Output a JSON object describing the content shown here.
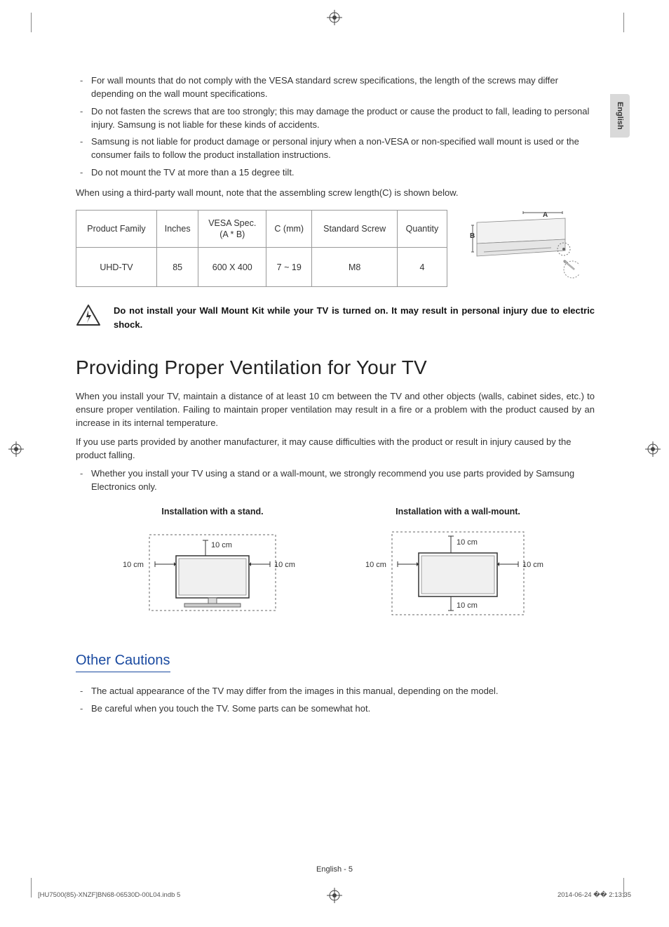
{
  "side_tab": "English",
  "warnings_top": [
    "For wall mounts that do not comply with the VESA standard screw specifications, the length of the screws may differ depending on the wall mount specifications.",
    "Do not fasten the screws that are too strongly; this may damage the product or cause the product to fall, leading to personal injury. Samsung is not liable for these kinds of accidents.",
    "Samsung is not liable for product damage or personal injury when a non-VESA or non-specified wall mount is used or the consumer fails to follow the product installation instructions.",
    "Do not mount the TV at more than a 15 degree tilt."
  ],
  "third_party_note": "When using a third-party wall mount, note that the assembling screw length(C) is shown below.",
  "table": {
    "headers": [
      "Product Family",
      "Inches",
      "VESA Spec.\n(A * B)",
      "C (mm)",
      "Standard Screw",
      "Quantity"
    ],
    "row": [
      "UHD-TV",
      "85",
      "600 X 400",
      "7 ~ 19",
      "M8",
      "4"
    ]
  },
  "bracket_labels": {
    "a": "A",
    "b": "B"
  },
  "shock_warning": "Do not install your Wall Mount Kit while your TV is turned on. It may result in personal injury due to electric shock.",
  "ventilation": {
    "heading": "Providing Proper Ventilation for Your TV",
    "p1": "When you install your TV, maintain a distance of at least 10 cm between the TV and other objects (walls, cabinet sides, etc.) to ensure proper ventilation. Failing to maintain proper ventilation may result in a fire or a problem with the product caused by an increase in its internal temperature.",
    "p2": "If you use parts provided by another manufacturer, it may cause difficulties with the product or result in injury caused by the product falling.",
    "bullet": "Whether you install your TV using a stand or a wall-mount, we strongly recommend you use parts provided by Samsung Electronics only.",
    "stand_caption": "Installation with a stand.",
    "wall_caption": "Installation with a wall-mount.",
    "dist": "10 cm"
  },
  "other": {
    "heading": "Other Cautions",
    "items": [
      "The actual appearance of the TV may differ from the images in this manual, depending on the model.",
      "Be careful when you touch the TV. Some parts can be somewhat hot."
    ]
  },
  "footer": {
    "page": "English - 5",
    "file": "[HU7500(85)-XNZF]BN68-06530D-00L04.indb   5",
    "stamp": "2014-06-24   �� 2:13:35"
  },
  "chart_data": {
    "type": "table",
    "headers": [
      "Product Family",
      "Inches",
      "VESA Spec. (A * B)",
      "C (mm)",
      "Standard Screw",
      "Quantity"
    ],
    "rows": [
      [
        "UHD-TV",
        "85",
        "600 X 400",
        "7 ~ 19",
        "M8",
        "4"
      ]
    ]
  }
}
